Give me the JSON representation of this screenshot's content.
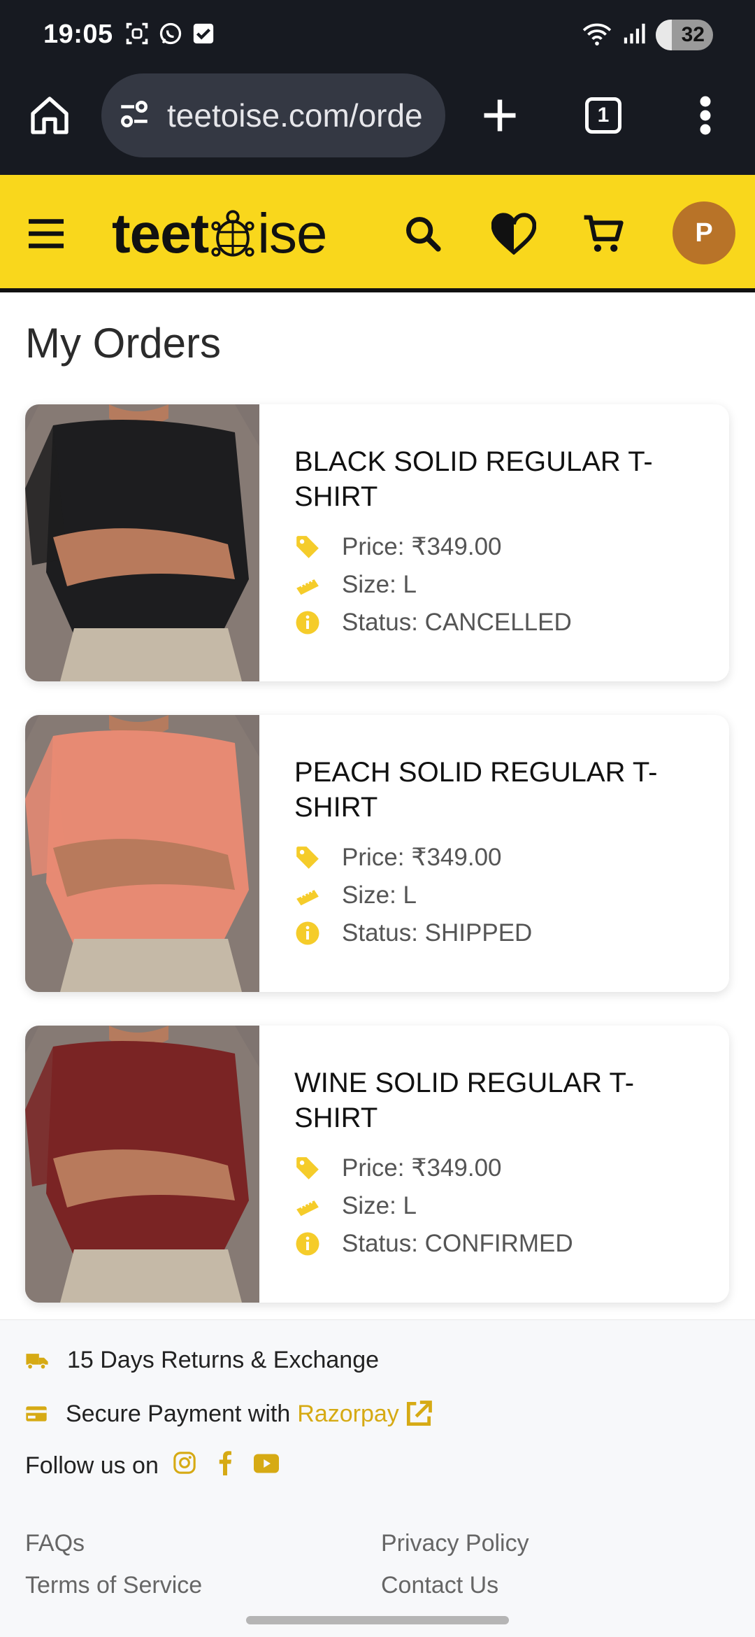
{
  "status_bar": {
    "time": "19:05",
    "battery": "32",
    "icons": [
      "screenshot-icon",
      "whatsapp-icon",
      "checkbox-icon",
      "wifi-icon",
      "signal-icon",
      "battery-icon"
    ]
  },
  "browser": {
    "url": "teetoise.com/orde",
    "tab_count": "1",
    "icons": [
      "home-icon",
      "site-settings-icon",
      "new-tab-icon",
      "tabs-icon",
      "more-icon"
    ]
  },
  "header": {
    "logo_prefix": "teet",
    "logo_suffix": "ise",
    "avatar_initial": "P",
    "icons": [
      "menu-icon",
      "search-icon",
      "wishlist-icon",
      "cart-icon"
    ],
    "colors": {
      "brand_yellow": "#f9d71c",
      "avatar": "#b87328",
      "accent_gold": "#d6aa14"
    }
  },
  "main": {
    "title": "My Orders",
    "orders": [
      {
        "name": "BLACK SOLID REGULAR T-SHIRT",
        "price": "Price: ₹349.00",
        "size": "Size: L",
        "status": "Status: CANCELLED",
        "shirt_color": "#1d1d1f"
      },
      {
        "name": "PEACH SOLID REGULAR T-SHIRT",
        "price": "Price: ₹349.00",
        "size": "Size: L",
        "status": "Status: SHIPPED",
        "shirt_color": "#e78a73"
      },
      {
        "name": "WINE SOLID REGULAR T-SHIRT",
        "price": "Price: ₹349.00",
        "size": "Size: L",
        "status": "Status: CONFIRMED",
        "shirt_color": "#7a2424"
      }
    ]
  },
  "footer": {
    "returns": "15 Days Returns & Exchange",
    "payment_prefix": "Secure Payment with",
    "payment_link": "Razorpay",
    "follow": "Follow us on",
    "links": {
      "faqs": "FAQs",
      "privacy": "Privacy Policy",
      "terms": "Terms of Service",
      "contact": "Contact Us"
    }
  }
}
